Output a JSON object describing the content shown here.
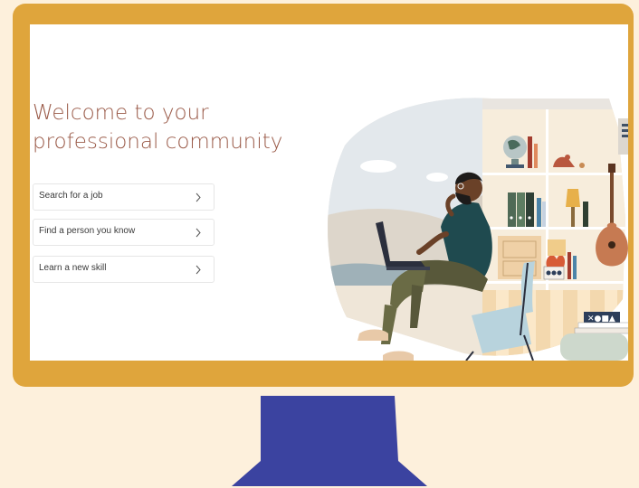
{
  "page": {
    "headline_line1": "Welcome to your",
    "headline_line2": "professional community"
  },
  "actions": [
    {
      "label": "Search for a job",
      "icon": "chevron-right-icon"
    },
    {
      "label": "Find a person you know",
      "icon": "chevron-right-icon"
    },
    {
      "label": "Learn a new skill",
      "icon": "chevron-right-icon"
    }
  ],
  "illustration": {
    "icon": "person-on-laptop-illustration"
  },
  "colors": {
    "background": "#fdf0dc",
    "monitor_bezel": "#dfa53c",
    "monitor_stand": "#3b43a0",
    "headline": "#9a5a48"
  }
}
